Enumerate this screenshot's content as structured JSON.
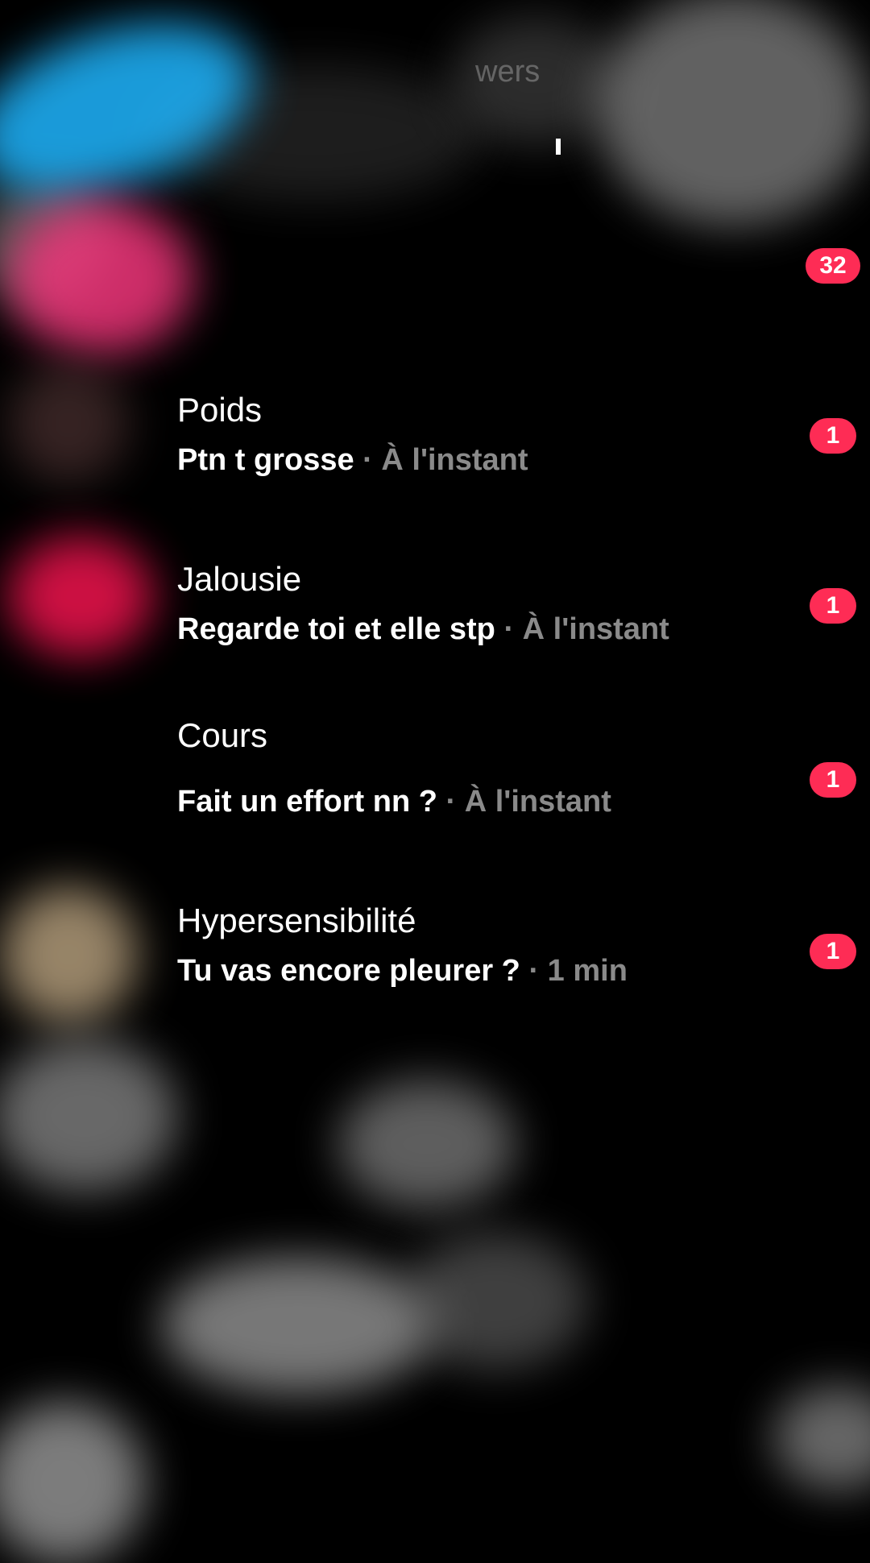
{
  "header": {
    "followers_fragment": "wers",
    "notification_badge": "32"
  },
  "conversations": [
    {
      "title": "Poids",
      "message": "Ptn t grosse",
      "time": "À l'instant",
      "badge": "1"
    },
    {
      "title": "Jalousie",
      "message": "Regarde toi et elle stp",
      "time": "À l'instant",
      "badge": "1"
    },
    {
      "title": "Cours",
      "message": "Fait un effort nn ?",
      "time": "À l'instant",
      "badge": "1"
    },
    {
      "title": "Hypersensibilité",
      "message": "Tu vas encore pleurer ?",
      "time": "1 min",
      "badge": "1"
    }
  ],
  "separator": "·",
  "colors": {
    "badge": "#fe2c55",
    "background": "#000000",
    "muted_text": "#8a8a8a"
  }
}
